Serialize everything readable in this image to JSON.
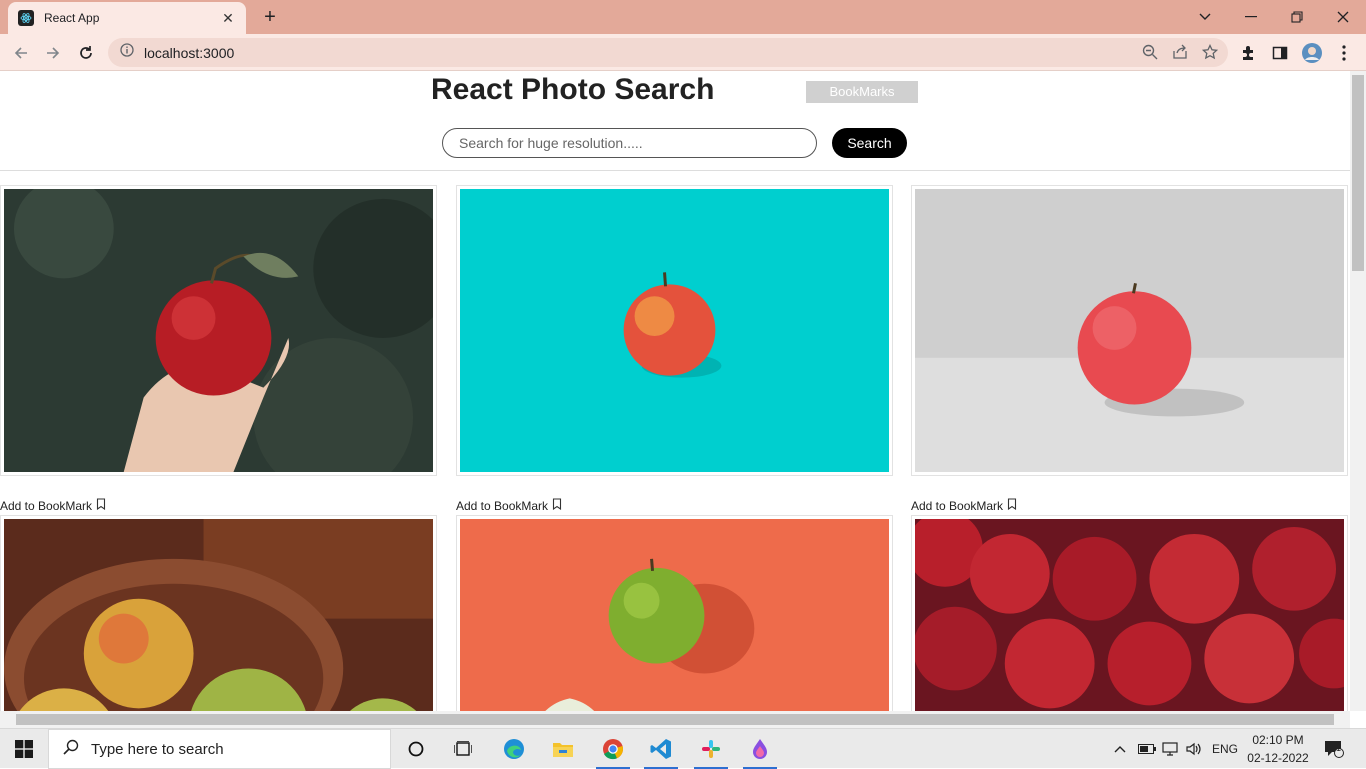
{
  "browser": {
    "tab_title": "React App",
    "tab_close": "✕",
    "new_tab": "+",
    "url": "localhost:3000"
  },
  "page": {
    "title": "React Photo Search",
    "bookmarks_button": "BookMarks",
    "search_placeholder": "Search for huge resolution.....",
    "search_button": "Search",
    "bookmark_label": "Add to BookMark"
  },
  "photos": [
    {
      "name": "apple-in-hand",
      "background": "#2c3a33"
    },
    {
      "name": "apple-on-teal",
      "background": "#00cfcf"
    },
    {
      "name": "apple-on-grey",
      "background": "#d4d4d4"
    },
    {
      "name": "apples-in-bowl",
      "background": "#5b2b1c"
    },
    {
      "name": "green-apple-on-orange",
      "background": "#ee6b4b"
    },
    {
      "name": "red-apples-pile",
      "background": "#7a1a22"
    }
  ],
  "taskbar": {
    "search_placeholder": "Type here to search",
    "language": "ENG",
    "time": "02:10 PM",
    "date": "02-12-2022",
    "notification_count": "1"
  }
}
